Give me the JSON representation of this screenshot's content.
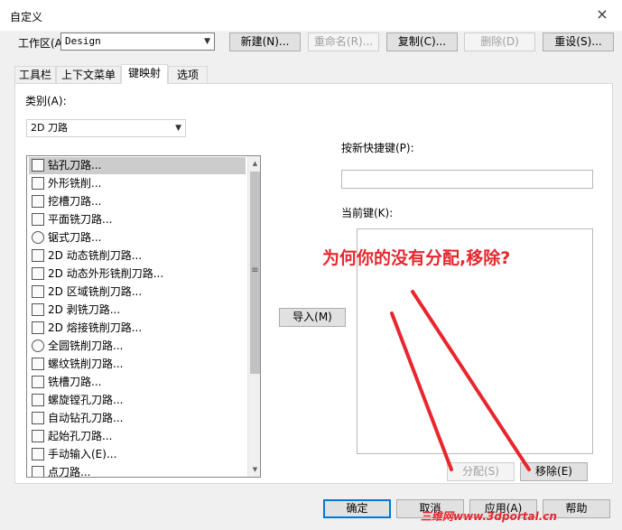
{
  "window": {
    "title": "自定义",
    "close_icon": "×"
  },
  "workspace": {
    "label": "工作区(A):",
    "value": "Design"
  },
  "toolbar": {
    "new": "新建(N)...",
    "rename": "重命名(R)...",
    "copy": "复制(C)...",
    "delete": "删除(D)",
    "reset": "重设(S)..."
  },
  "tabs": [
    "工具栏",
    "上下文菜单",
    "键映射",
    "选项"
  ],
  "category": {
    "label": "类别(A):",
    "value": "2D 刀路"
  },
  "commands": [
    "钻孔刀路...",
    "外形铣削...",
    "挖槽刀路...",
    "平面铣刀路...",
    "锯式刀路...",
    "2D 动态铣削刀路...",
    "2D 动态外形铣削刀路...",
    "2D 区域铣削刀路...",
    "2D 剥铣刀路...",
    "2D 熔接铣削刀路...",
    "全圆铣削刀路...",
    "螺纹铣削刀路...",
    "铣槽刀路...",
    "螺旋镗孔刀路...",
    "自动钻孔刀路...",
    "起始孔刀路...",
    "手动输入(E)...",
    "点刀路..."
  ],
  "import_button": "导入(M)",
  "new_shortcut_label": "按新快捷键(P):",
  "current_keys_label": "当前键(K):",
  "assign_button": "分配(S)",
  "remove_button": "移除(E)",
  "annotation": "为何你的没有分配,移除?",
  "footer": {
    "ok": "确定",
    "cancel": "取消",
    "apply": "应用(A)",
    "help": "帮助"
  },
  "watermark": "三维网www.3dportal.cn"
}
